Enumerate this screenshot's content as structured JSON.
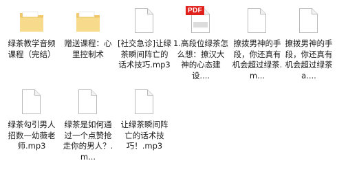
{
  "files": [
    {
      "name": "绿茶教学音频课程（完结）",
      "kind": "folder"
    },
    {
      "name": "赠送课程：心里控制术",
      "kind": "folder"
    },
    {
      "name": "[社交急诊]让绿茶瞬间阵亡的话术技巧.mp3",
      "kind": "file"
    },
    {
      "name": "1.高段位绿茶怎么想：撩汉大神的心态建设....",
      "kind": "pdf",
      "badge": "PDF"
    },
    {
      "name": "撩拨男神的手段，你还真有机会超过绿茶.m...",
      "kind": "file"
    },
    {
      "name": "撩拨男神的手段，你还真有机会超过绿茶a....",
      "kind": "file"
    },
    {
      "name": "绿茶勾引男人招数—幼薇老师.mp3",
      "kind": "file"
    },
    {
      "name": "绿茶是如何通过一个点赞抢走你的男人？.m...",
      "kind": "file"
    },
    {
      "name": "让绿茶瞬间阵亡的话术技巧！.mp3",
      "kind": "file"
    }
  ],
  "colors": {
    "folder_back": "#f2c86a",
    "folder_front": "#f7da8c",
    "file_border": "#b9b9b9",
    "pdf_red": "#e0201b"
  }
}
